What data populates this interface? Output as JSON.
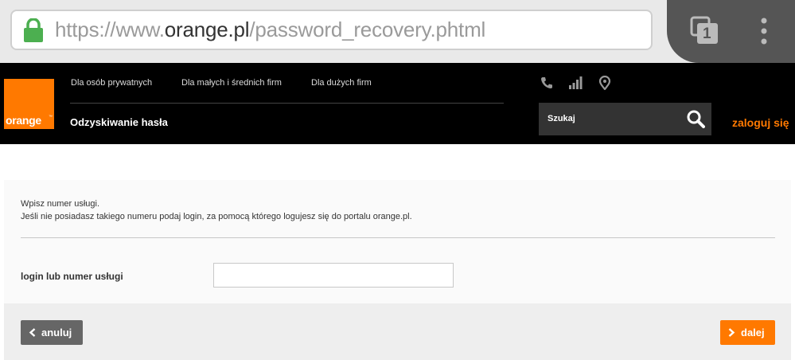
{
  "browser": {
    "url_prefix": "https://www.",
    "url_host": "orange.pl",
    "url_path": "/password_recovery.phtml",
    "tab_count": "1",
    "icons": {
      "lock": "lock-icon",
      "tabs": "tabs-icon",
      "menu": "more-vert-icon"
    }
  },
  "header": {
    "logo_text": "orange",
    "logo_tm": "™",
    "nav": [
      "Dla osób prywatnych",
      "Dla małych i średnich firm",
      "Dla dużych firm"
    ],
    "page_title": "Odzyskiwanie hasła",
    "icons": [
      "phone-icon",
      "signal-icon",
      "location-icon"
    ],
    "search_label": "Szukaj",
    "login_link": "zaloguj się"
  },
  "form": {
    "instruction_line1": "Wpisz numer usługi.",
    "instruction_line2": "Jeśli nie posiadasz takiego numeru podaj login, za pomocą którego logujesz się do portalu orange.pl.",
    "field_label": "login lub numer usługi",
    "field_value": ""
  },
  "actions": {
    "cancel_label": "anuluj",
    "next_label": "dalej"
  },
  "colors": {
    "brand": "#ff7900",
    "header_bg": "#000000",
    "cancel_bg": "#666666"
  }
}
